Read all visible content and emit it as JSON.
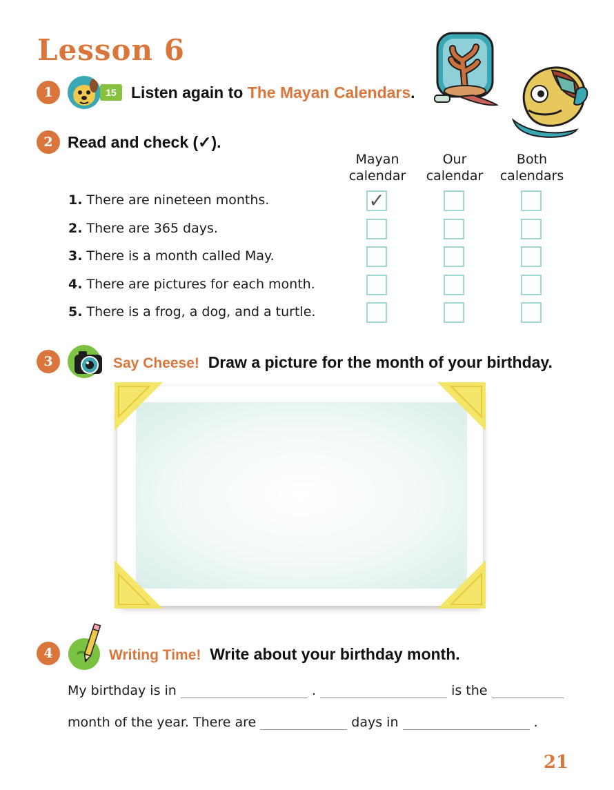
{
  "lesson_title": "Lesson 6",
  "page_number": "21",
  "activities": [
    {
      "number": "1",
      "track": "15",
      "instruction": "Listen again to ",
      "story_title": "The Mayan Calendars",
      "end": "."
    },
    {
      "number": "2",
      "instruction": "Read and check (✓)."
    },
    {
      "number": "3",
      "label": "Say Cheese!",
      "instruction": "Draw a picture for the month of your birthday."
    },
    {
      "number": "4",
      "label": "Writing Time!",
      "instruction": "Write about your birthday month."
    }
  ],
  "table": {
    "columns": [
      {
        "line1": "Mayan",
        "line2": "calendar"
      },
      {
        "line1": "Our",
        "line2": "calendar"
      },
      {
        "line1": "Both",
        "line2": "calendars"
      }
    ],
    "rows": [
      {
        "num": "1.",
        "text": "There are nineteen months.",
        "checked": [
          true,
          false,
          false
        ],
        "mark": "✓"
      },
      {
        "num": "2.",
        "text": "There are 365 days.",
        "checked": [
          false,
          false,
          false
        ],
        "mark": ""
      },
      {
        "num": "3.",
        "text": "There is a month called May.",
        "checked": [
          false,
          false,
          false
        ],
        "mark": ""
      },
      {
        "num": "4.",
        "text": "There are pictures for each month.",
        "checked": [
          false,
          false,
          false
        ],
        "mark": ""
      },
      {
        "num": "5.",
        "text": "There is a frog, a dog, and a turtle.",
        "checked": [
          false,
          false,
          false
        ],
        "mark": ""
      }
    ]
  },
  "writing": {
    "line1_start": "My birthday is in",
    "line1_period": ".",
    "line1_mid": "is the",
    "line2_start": "month of the year. There are",
    "line2_mid": "days in",
    "line2_end": "."
  },
  "colors": {
    "accent": "#d9763c",
    "checkbox_border": "#9fd6cf",
    "badge_green": "#86c23f",
    "corner_yellow": "#f3e35a"
  },
  "icons": [
    "dog-audio-icon",
    "camera-icon",
    "pencil-icon",
    "mayan-glyph-tree-icon",
    "mayan-glyph-face-icon"
  ]
}
